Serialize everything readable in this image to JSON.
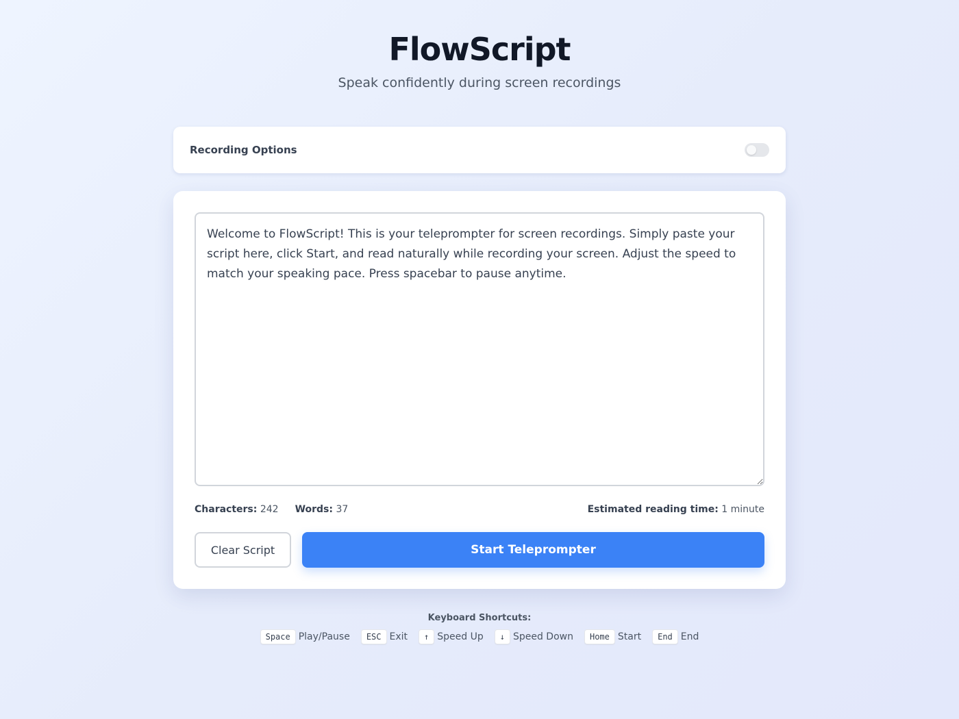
{
  "header": {
    "title": "FlowScript",
    "subtitle": "Speak confidently during screen recordings"
  },
  "options": {
    "label": "Recording Options",
    "toggle_on": false
  },
  "editor": {
    "script_text": "Welcome to FlowScript! This is your teleprompter for screen recordings. Simply paste your script here, click Start, and read naturally while recording your screen. Adjust the speed to match your speaking pace. Press spacebar to pause anytime."
  },
  "stats": {
    "characters_label": "Characters:",
    "characters_value": "242",
    "words_label": "Words:",
    "words_value": "37",
    "reading_time_label": "Estimated reading time:",
    "reading_time_value": "1 minute"
  },
  "actions": {
    "clear_label": "Clear Script",
    "start_label": "Start Teleprompter"
  },
  "shortcuts": {
    "title": "Keyboard Shortcuts:",
    "items": [
      {
        "key": "Space",
        "action": "Play/Pause"
      },
      {
        "key": "ESC",
        "action": "Exit"
      },
      {
        "key": "↑",
        "action": "Speed Up"
      },
      {
        "key": "↓",
        "action": "Speed Down"
      },
      {
        "key": "Home",
        "action": "Start"
      },
      {
        "key": "End",
        "action": "End"
      }
    ]
  },
  "colors": {
    "accent": "#3b82f6",
    "text": "#111827"
  }
}
